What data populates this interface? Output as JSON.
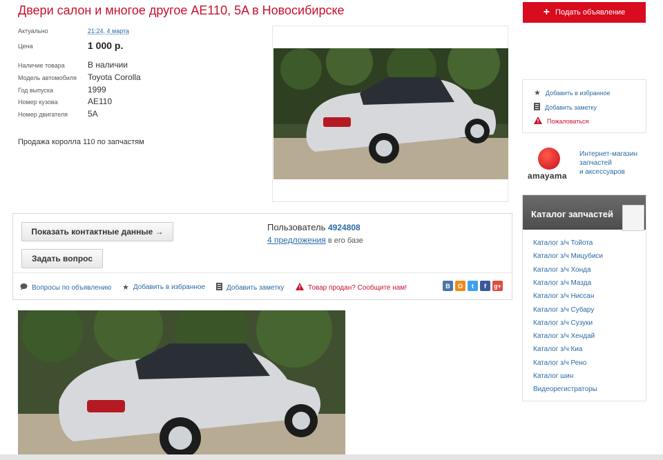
{
  "listing": {
    "title": "Двери салон и многое другое AE110, 5A в Новосибирске",
    "specs": {
      "actual_label": "Актуально",
      "actual_value": "21:24, 4 марта",
      "price_label": "Цена",
      "price_value": "1 000 р.",
      "availability_label": "Наличие товара",
      "availability_value": "В наличии",
      "model_label": "Модель автомобиля",
      "model_value": "Toyota Corolla",
      "year_label": "Год выпуска",
      "year_value": "1999",
      "body_label": "Номер кузова",
      "body_value": "AE110",
      "engine_label": "Номер двигателя",
      "engine_value": "5A"
    },
    "description": "Продажа королла 110 по запчастям"
  },
  "contact": {
    "show_contacts_label": "Показать контактные данные →",
    "ask_question_label": "Задать вопрос",
    "user_prefix": "Пользователь",
    "user_id": "4924808",
    "offers_link": "4 предложения",
    "offers_suffix": "в его базе",
    "actions": {
      "questions": "Вопросы по объявлению",
      "add_favorite": "Добавить в избранное",
      "add_note": "Добавить заметку",
      "sold_report": "Товар продан? Сообщите нам!"
    },
    "social": [
      "В",
      "О",
      "t",
      "f",
      "g+"
    ]
  },
  "sidebar": {
    "post_ad_label": "Подать объявление",
    "fav_box": {
      "add_favorite": "Добавить в избранное",
      "add_note": "Добавить заметку",
      "complain": "Пожаловаться"
    },
    "amayama": {
      "brand": "amayama",
      "line1": "Интернет-магазин",
      "line2": "запчастей",
      "line3": "и аксессуаров"
    },
    "catalog": {
      "title": "Каталог запчастей",
      "items": [
        "Каталог з/ч Тойота",
        "Каталог з/ч Мицубиси",
        "Каталог з/ч Хонда",
        "Каталог з/ч Мазда",
        "Каталог з/ч Ниссан",
        "Каталог з/ч Субару",
        "Каталог з/ч Сузуки",
        "Каталог з/ч Хендай",
        "Каталог з/ч Киа",
        "Каталог з/ч Рено",
        "Каталог шин",
        "Видеорегистраторы"
      ]
    }
  },
  "colors": {
    "accent_red": "#c8102e",
    "link_blue": "#2a6aa6",
    "button_red": "#d90b1f"
  }
}
